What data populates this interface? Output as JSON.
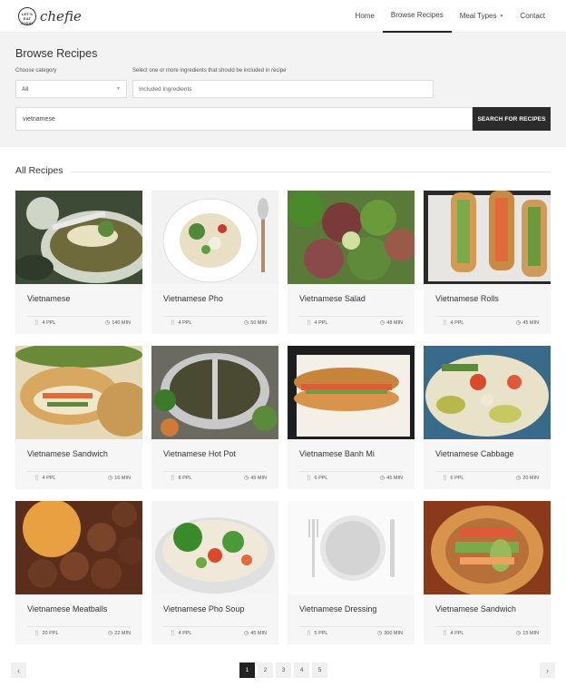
{
  "brand": {
    "badge": "LET'S\nEAT\nTODAY",
    "name": "chefie"
  },
  "nav": {
    "items": [
      {
        "label": "Home"
      },
      {
        "label": "Browse Recipes"
      },
      {
        "label": "Meal Types"
      },
      {
        "label": "Contact"
      }
    ]
  },
  "search": {
    "title": "Browse Recipes",
    "category_label": "Choose category",
    "category_value": "All",
    "ingredients_label": "Select one or more ingredients that should be included in recipe",
    "ingredients_placeholder": "Included Ingredients",
    "query": "vietnamese",
    "button_label": "SEARCH FOR RECIPES"
  },
  "section": {
    "title": "All Recipes"
  },
  "recipes": [
    {
      "title": "Vietnamese",
      "ppl": "4 PPL",
      "min": "140 MIN",
      "img": "pho"
    },
    {
      "title": "Vietnamese Pho",
      "ppl": "4 PPL",
      "min": "50 MIN",
      "img": "pho-white"
    },
    {
      "title": "Vietnamese Salad",
      "ppl": "4 PPL",
      "min": "48 MIN",
      "img": "salad"
    },
    {
      "title": "Vietnamese Rolls",
      "ppl": "4 PPL",
      "min": "45 MIN",
      "img": "rolls"
    },
    {
      "title": "Vietnamese Sandwich",
      "ppl": "4 PPL",
      "min": "16 MIN",
      "img": "banhmi"
    },
    {
      "title": "Vietnamese Hot Pot",
      "ppl": "8 PPL",
      "min": "45 MIN",
      "img": "hotpot"
    },
    {
      "title": "Vietnamese Banh Mi",
      "ppl": "6 PPL",
      "min": "45 MIN",
      "img": "banhmi2"
    },
    {
      "title": "Vietnamese Cabbage",
      "ppl": "6 PPL",
      "min": "20 MIN",
      "img": "cabbage"
    },
    {
      "title": "Vietnamese Meatballs",
      "ppl": "20 PPL",
      "min": "22 MIN",
      "img": "meatballs"
    },
    {
      "title": "Vietnamese Pho Soup",
      "ppl": "4 PPL",
      "min": "45 MIN",
      "img": "noodles"
    },
    {
      "title": "Vietnamese Dressing",
      "ppl": "5 PPL",
      "min": "300 MIN",
      "img": "placeholder"
    },
    {
      "title": "Vietnamese Sandwich",
      "ppl": "4 PPL",
      "min": "15 MIN",
      "img": "sandwich"
    }
  ],
  "pagination": {
    "pages": [
      "1",
      "2",
      "3",
      "4",
      "5"
    ],
    "current": "1",
    "prev": "‹",
    "next": "›"
  },
  "icons": {
    "people": "utensils-icon",
    "time": "clock-icon"
  }
}
